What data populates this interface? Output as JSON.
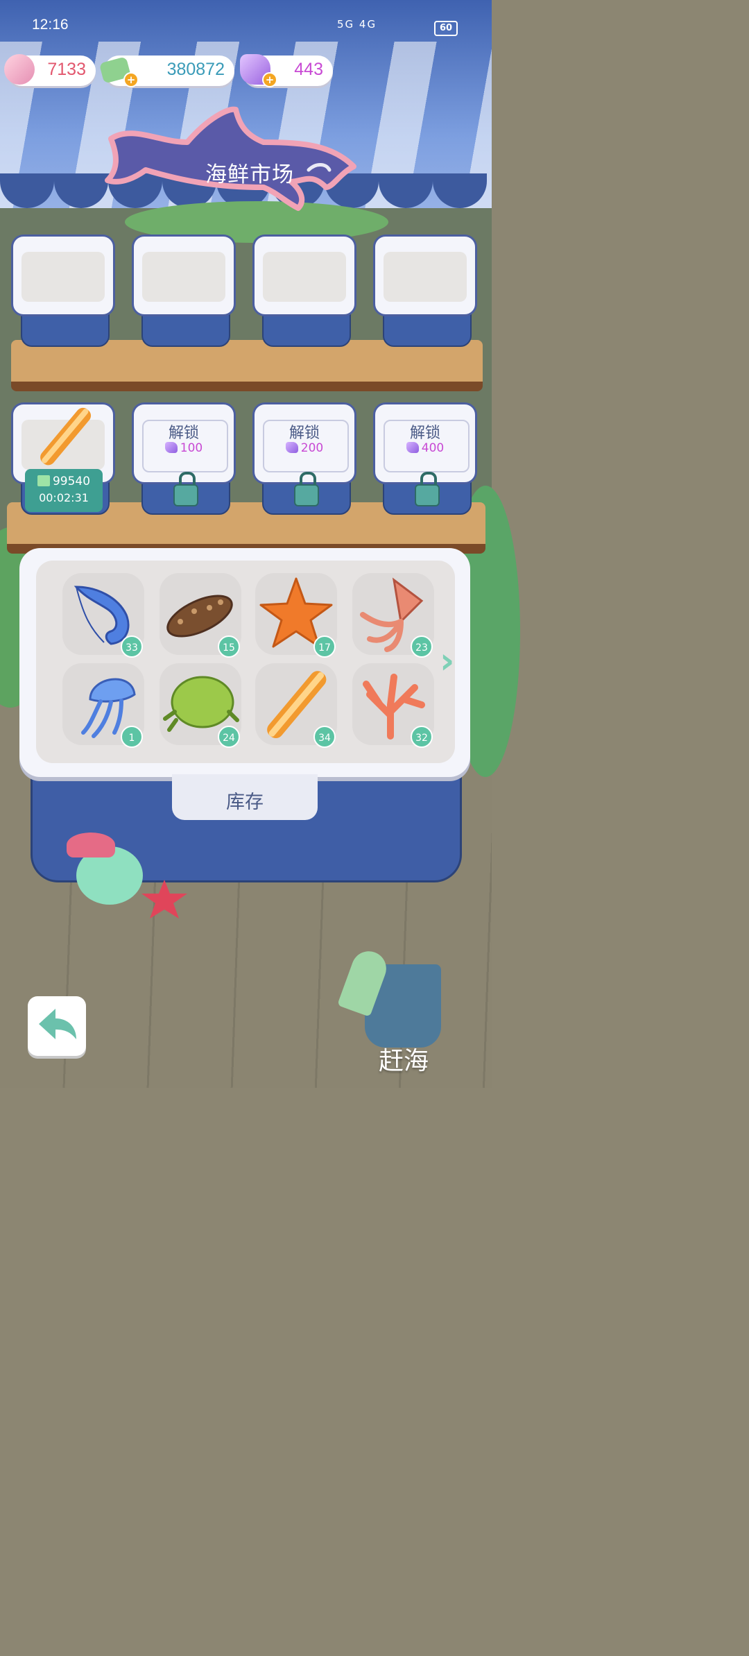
{
  "status_bar": {
    "time": "12:16",
    "signal_icons": "5G 4G",
    "battery": "60"
  },
  "currencies": [
    {
      "name": "shell",
      "value": "7133",
      "color": "#e2576e"
    },
    {
      "name": "cash",
      "value": "380872",
      "color": "#3a9bb8"
    },
    {
      "name": "gem",
      "value": "443",
      "color": "#c84ad4"
    }
  ],
  "title": "海鲜市场",
  "top_shelf": {
    "slots": [
      "empty",
      "empty",
      "empty",
      "empty"
    ]
  },
  "second_shelf": {
    "active_slot": {
      "item": "razor-clam",
      "price": "99540",
      "timer": "00:02:31"
    },
    "locked_slots": [
      {
        "label": "解锁",
        "price": "100"
      },
      {
        "label": "解锁",
        "price": "200"
      },
      {
        "label": "解锁",
        "price": "400"
      }
    ]
  },
  "inventory": {
    "label": "库存",
    "items": [
      {
        "name": "shrimp",
        "count": "33"
      },
      {
        "name": "sea-cucumber",
        "count": "15"
      },
      {
        "name": "starfish",
        "count": "17"
      },
      {
        "name": "squid",
        "count": "23"
      },
      {
        "name": "jellyfish",
        "count": "1"
      },
      {
        "name": "crab",
        "count": "24"
      },
      {
        "name": "razor-clam",
        "count": "34"
      },
      {
        "name": "coral",
        "count": "32"
      }
    ]
  },
  "buttons": {
    "back_icon": "back-arrow-icon",
    "sea_label": "赶海"
  }
}
